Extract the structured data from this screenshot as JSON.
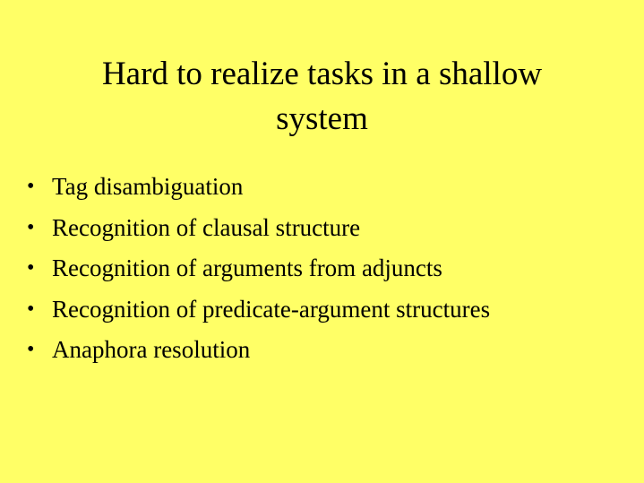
{
  "slide": {
    "title_line1": "Hard to realize tasks in a shallow",
    "title_line2": "system",
    "bullet_glyph": "•",
    "bullets": [
      "Tag disambiguation",
      "Recognition of clausal structure",
      "Recognition of arguments from adjuncts",
      "Recognition of predicate-argument structures",
      "Anaphora resolution"
    ],
    "background_color": "#ffff66"
  }
}
